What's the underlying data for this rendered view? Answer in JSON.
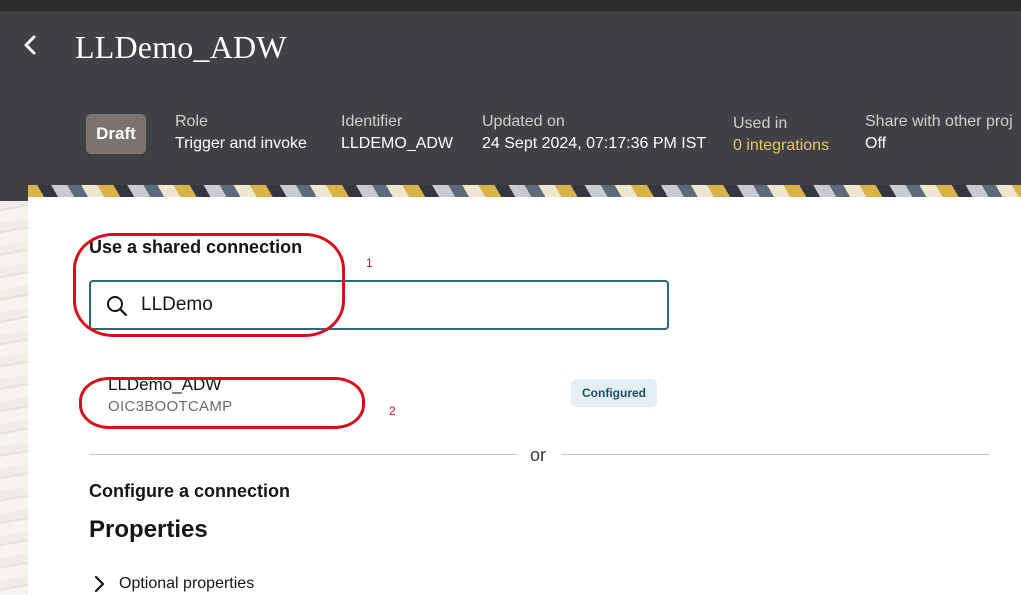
{
  "header": {
    "title": "LLDemo_ADW",
    "status_badge": "Draft",
    "meta": [
      {
        "label": "Role",
        "value": "Trigger and invoke"
      },
      {
        "label": "Identifier",
        "value": "LLDEMO_ADW"
      },
      {
        "label": "Updated on",
        "value": "24 Sept 2024, 07:17:36 PM IST"
      },
      {
        "label": "Used in",
        "value": "0 integrations"
      },
      {
        "label": "Share with other proj",
        "value": "Off"
      }
    ]
  },
  "shared": {
    "heading": "Use a shared connection",
    "search_value": "LLDemo",
    "result": {
      "name": "LLDemo_ADW",
      "subtitle": "OIC3BOOTCAMP",
      "status": "Configured"
    },
    "or_label": "or"
  },
  "configure": {
    "heading": "Configure a connection",
    "properties_heading": "Properties",
    "optional_label": "Optional properties"
  },
  "annotations": {
    "one": "1",
    "two": "2"
  },
  "icons": {
    "back": "chevron-left-icon",
    "search": "search-icon",
    "expand": "chevron-right-icon"
  },
  "colors": {
    "header_bg": "#3f4145",
    "badge_bg": "#7a736e",
    "link": "#e8c56b",
    "focus_border": "#2b6a7a",
    "annotation": "#d6101a"
  }
}
